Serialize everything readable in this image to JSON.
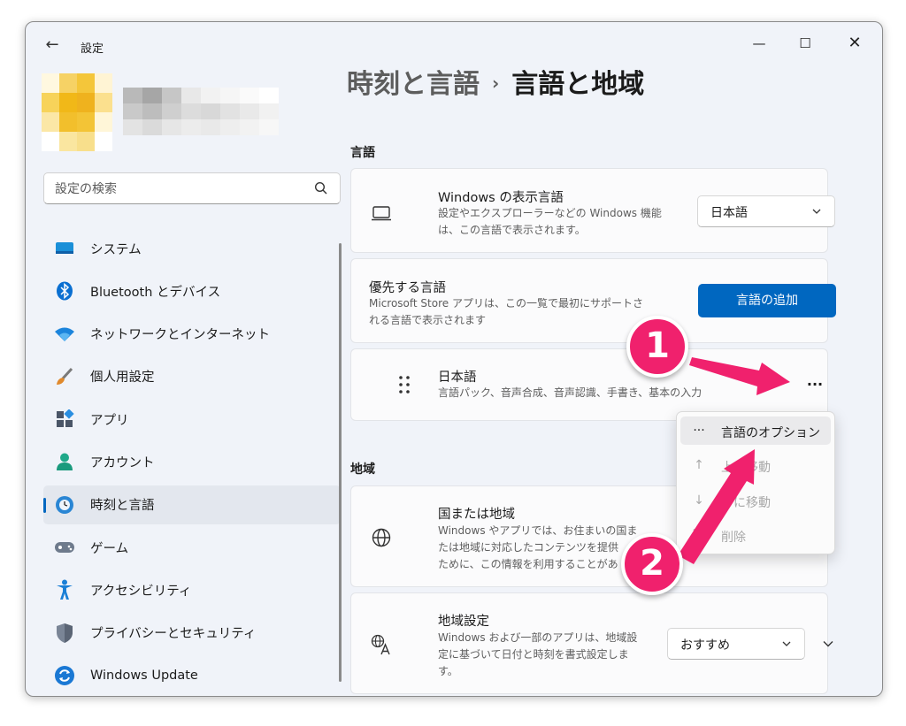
{
  "window": {
    "app_title": "設定",
    "back": "←",
    "minimize": "—",
    "maximize": "☐",
    "close": "✕"
  },
  "search": {
    "placeholder": "設定の検索"
  },
  "sidebar": {
    "items": [
      {
        "label": "システム",
        "icon": "system-icon"
      },
      {
        "label": "Bluetooth とデバイス",
        "icon": "bluetooth-icon"
      },
      {
        "label": "ネットワークとインターネット",
        "icon": "wifi-icon"
      },
      {
        "label": "個人用設定",
        "icon": "brush-icon"
      },
      {
        "label": "アプリ",
        "icon": "apps-icon"
      },
      {
        "label": "アカウント",
        "icon": "account-icon"
      },
      {
        "label": "時刻と言語",
        "icon": "time-language-icon",
        "active": true
      },
      {
        "label": "ゲーム",
        "icon": "gamepad-icon"
      },
      {
        "label": "アクセシビリティ",
        "icon": "accessibility-icon"
      },
      {
        "label": "プライバシーとセキュリティ",
        "icon": "shield-icon"
      },
      {
        "label": "Windows Update",
        "icon": "update-icon"
      }
    ]
  },
  "breadcrumb": {
    "parent": "時刻と言語",
    "separator": "›",
    "current": "言語と地域"
  },
  "language_section": {
    "title": "言語",
    "display_language": {
      "title": "Windows の表示言語",
      "desc_line1": "設定やエクスプローラーなどの Windows 機能",
      "desc_line2": "は、この言語で表示されます。",
      "value": "日本語"
    },
    "preferred": {
      "title": "優先する言語",
      "desc_line1": "Microsoft Store アプリは、この一覧で最初にサポートさ",
      "desc_line2": "れる言語で表示されます",
      "button": "言語の追加"
    },
    "japanese": {
      "title": "日本語",
      "desc": "言語パック、音声合成、音声認識、手書き、基本の入力",
      "more": "···"
    }
  },
  "context_menu": {
    "items": [
      {
        "label": "言語のオプション",
        "icon": "···"
      },
      {
        "label": "上に移動",
        "icon": "↑"
      },
      {
        "label": "下に移動",
        "icon": "↓"
      },
      {
        "label": "削除",
        "icon": "🗑"
      }
    ]
  },
  "region_section": {
    "title": "地域",
    "country": {
      "title": "国または地域",
      "desc_line1": "Windows やアプリでは、お住まいの国ま",
      "desc_line2": "たは地域に対応したコンテンツを提供",
      "desc_line3": "ために、この情報を利用することがあ"
    },
    "format": {
      "title": "地域設定",
      "desc_line1": "Windows および一部のアプリは、地域設",
      "desc_line2": "定に基づいて日付と時刻を書式設定しま",
      "desc_line3": "す。",
      "value": "おすすめ"
    }
  },
  "annotations": {
    "badge1": "1",
    "badge2": "2"
  },
  "colors": {
    "accent": "#0067c0",
    "annotation": "#f0216d"
  }
}
